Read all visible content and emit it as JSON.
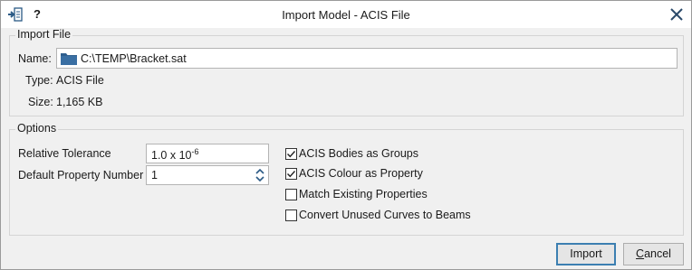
{
  "titlebar": {
    "title": "Import Model - ACIS File",
    "help_label": "?",
    "app_icon": "import-arrow-icon",
    "close_icon": "close-icon"
  },
  "import_file": {
    "group_label": "Import File",
    "name_label": "Name:",
    "name_value": "C:\\TEMP\\Bracket.sat",
    "type_label": "Type:",
    "type_value": "ACIS File",
    "size_label": "Size:",
    "size_value": "1,165 KB"
  },
  "options": {
    "group_label": "Options",
    "relative_tolerance_label": "Relative Tolerance",
    "relative_tolerance_base": "1.0 x 10",
    "relative_tolerance_exp": "-6",
    "default_property_label": "Default Property Number",
    "default_property_value": "1",
    "checkboxes": [
      {
        "label": "ACIS Bodies as Groups",
        "checked": true
      },
      {
        "label": "ACIS Colour as Property",
        "checked": true
      },
      {
        "label": "Match Existing Properties",
        "checked": false
      },
      {
        "label": "Convert Unused Curves to Beams",
        "checked": false
      }
    ]
  },
  "buttons": {
    "import_label": "Import",
    "cancel_label": "Cancel"
  },
  "colors": {
    "folder": "#2f5f8f",
    "default_button_border": "#3c7fb1"
  }
}
